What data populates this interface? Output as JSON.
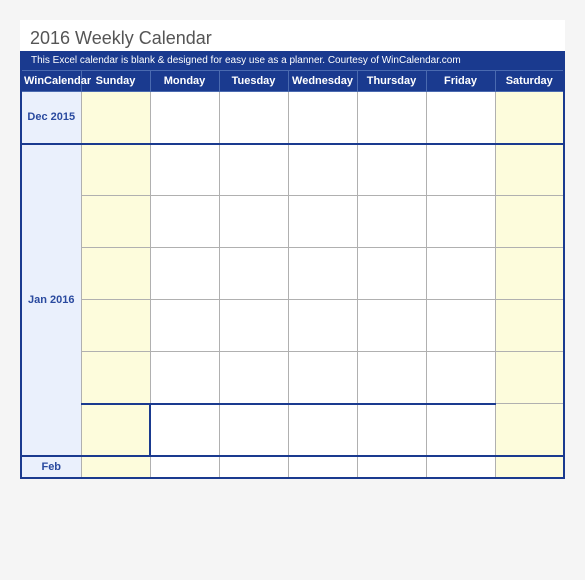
{
  "title": "2016 Weekly Calendar",
  "subtitle": "This Excel calendar is blank & designed for easy use as a planner.  Courtesy of WinCalendar.com",
  "header": {
    "brand": "WinCalendar",
    "days": [
      "Sunday",
      "Monday",
      "Tuesday",
      "Wednesday",
      "Thursday",
      "Friday",
      "Saturday"
    ]
  },
  "months": {
    "m0": "Dec 2015",
    "m1": "Jan 2016",
    "m2": "Feb"
  }
}
